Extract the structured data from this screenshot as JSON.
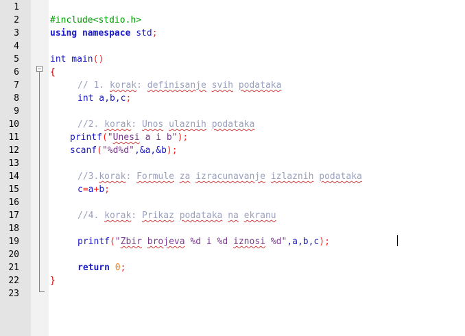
{
  "line_numbers": [
    "1",
    "2",
    "3",
    "4",
    "5",
    "6",
    "7",
    "8",
    "9",
    "10",
    "11",
    "12",
    "13",
    "14",
    "15",
    "16",
    "17",
    "18",
    "19",
    "20",
    "21",
    "22",
    "23"
  ],
  "code": {
    "l2": "#include<stdio.h>",
    "l3_kw": "using namespace",
    "l3_rest": " std",
    "l3_semi": ";",
    "l5_type": "int",
    "l5_name": " main",
    "l5_parens": "()",
    "l6_brace": "{",
    "l7_comment": "// 1. ",
    "l7_sq1": "korak",
    "l7_c2": ": ",
    "l7_sq2": "definisanje",
    "l7_c3": " ",
    "l7_sq3": "svih",
    "l7_c4": " ",
    "l7_sq4": "podataka",
    "l8_type": "int",
    "l8_rest": " a,b,c",
    "l8_semi": ";",
    "l10_c1": "//2. ",
    "l10_sq1": "korak",
    "l10_c2": ": ",
    "l10_sq2": "Unos",
    "l10_c3": " ",
    "l10_sq3": "ulaznih",
    "l10_c4": " ",
    "l10_sq4": "podataka",
    "l11_fn": "printf",
    "l11_p1": "(",
    "l11_q1": "\"",
    "l11_sq": "Unesi",
    "l11_s": " a i b\"",
    "l11_p2": ");",
    "l12_fn": "scanf",
    "l12_p1": "(",
    "l12_s": "\"%d%d\"",
    "l12_rest": ",&a,&b",
    "l12_p2": ");",
    "l14_c1": "//3.",
    "l14_sq1": "korak",
    "l14_c2": ": ",
    "l14_sq2": "Formule",
    "l14_c3": " ",
    "l14_sq3": "za",
    "l14_c4": " ",
    "l14_sq4": "izracunavanje",
    "l14_c5": " ",
    "l14_sq5": "izlaznih",
    "l14_c6": " ",
    "l14_sq6": "podataka",
    "l15_a": "c",
    "l15_eq": "=",
    "l15_b": "a",
    "l15_plus": "+",
    "l15_c": "b",
    "l15_semi": ";",
    "l17_c1": "//4. ",
    "l17_sq1": "korak",
    "l17_c2": ": ",
    "l17_sq2": "Prikaz",
    "l17_c3": " ",
    "l17_sq3": "podataka",
    "l17_c4": " ",
    "l17_sq4": "na",
    "l17_c5": " ",
    "l17_sq5": "ekranu",
    "l19_fn": "printf",
    "l19_p1": "(",
    "l19_s1": "\"",
    "l19_sq1": "Zbir",
    "l19_s2": " ",
    "l19_sq2": "brojeva",
    "l19_s3": " %d i %d ",
    "l19_sq3": "iznosi",
    "l19_s4": " %d\"",
    "l19_rest": ",a,b,c",
    "l19_p2": ");",
    "l21_kw": "return",
    "l21_num": " 0",
    "l21_semi": ";",
    "l22_brace": "}"
  },
  "colors": {
    "change_marker": "#19c319",
    "keyword": "#1b1bc4",
    "preprocessor": "#009900",
    "comment": "#9aa0bd",
    "string": "#7b3a8f",
    "operator": "#ff1f1f"
  }
}
